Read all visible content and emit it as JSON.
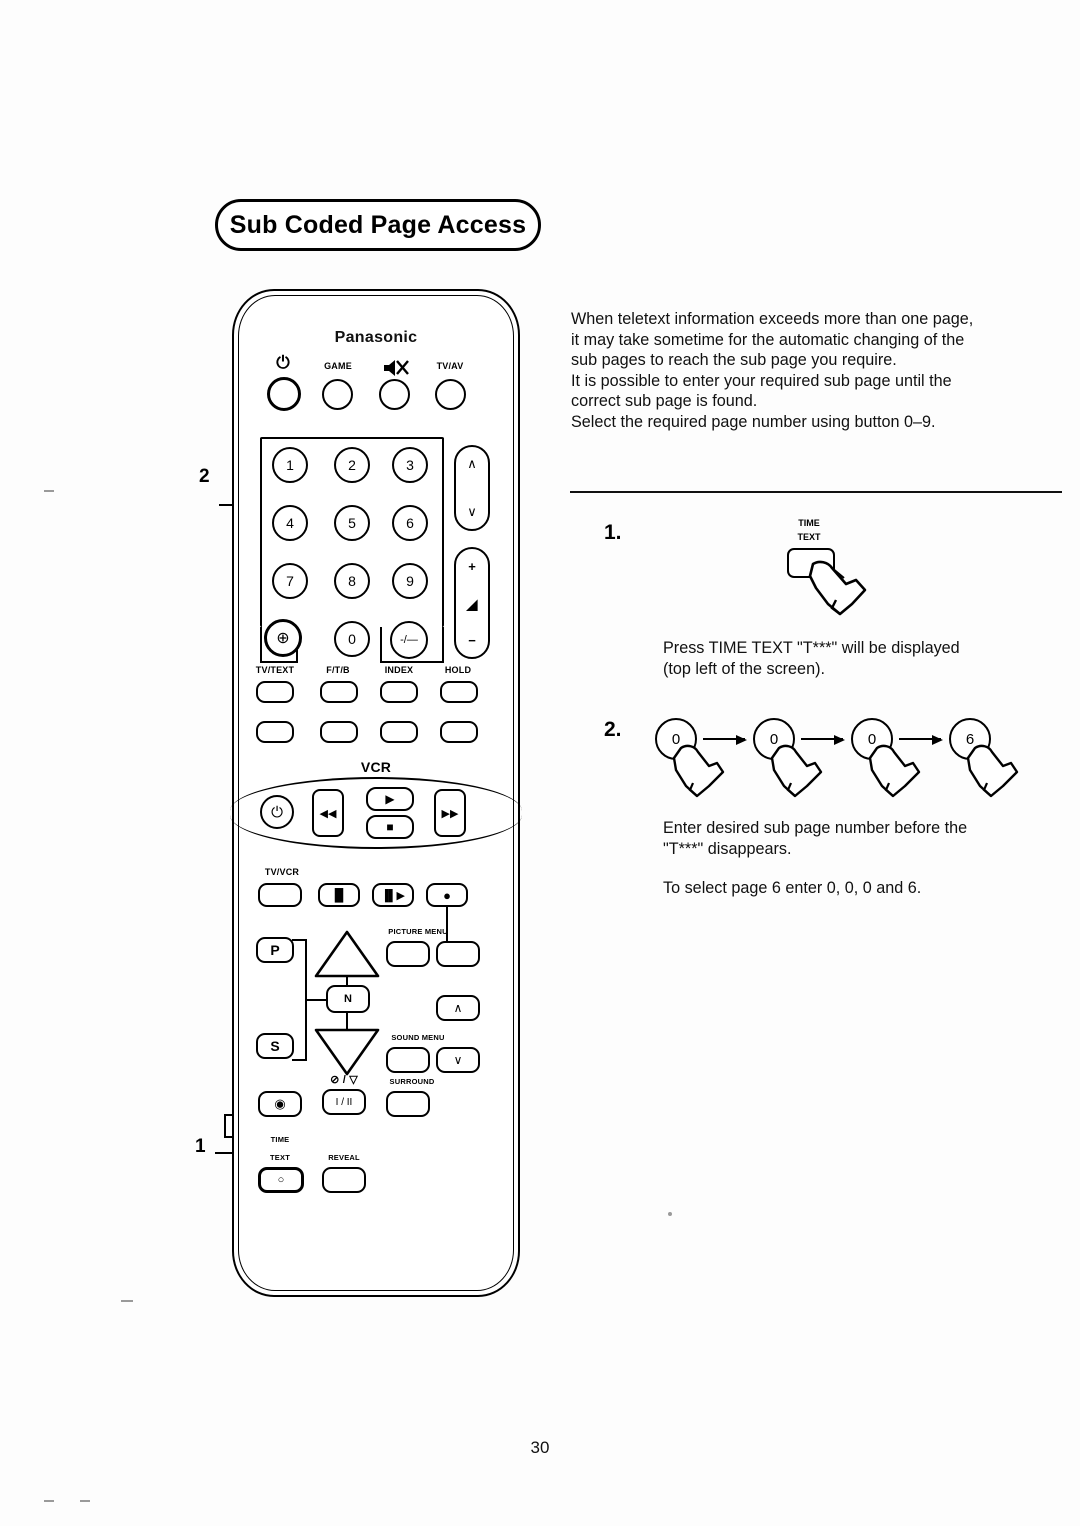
{
  "title": "Sub Coded Page Access",
  "page_number": "30",
  "intro": {
    "lines": [
      "When teletext information exceeds more than one page,",
      "it may take  sometime for the automatic changing of the",
      "sub pages to reach the sub page you require.",
      "It is possible to enter your required sub page until the",
      "correct sub page is found.",
      "Select the required page number using button 0–9."
    ]
  },
  "steps": [
    {
      "number": "1.",
      "key_label_top": "TIME",
      "key_label_bottom": "TEXT",
      "lines": [
        "Press TIME TEXT \"T***\" will be displayed",
        "(top left of the screen)."
      ]
    },
    {
      "number": "2.",
      "keys": [
        "0",
        "0",
        "0",
        "6"
      ],
      "lines": [
        "Enter desired sub page number before the",
        "\"T***\"   disappears.",
        "To select page 6 enter 0, 0, 0 and 6."
      ]
    }
  ],
  "callouts": [
    {
      "label": "2",
      "points_to": "numeric-keypad"
    },
    {
      "label": "1",
      "points_to": "time-text-button"
    }
  ],
  "remote": {
    "brand": "Panasonic",
    "top_row": [
      {
        "name": "power",
        "glyph": "⏻",
        "label": ""
      },
      {
        "name": "game",
        "glyph": "",
        "label": "GAME"
      },
      {
        "name": "mute",
        "glyph": "",
        "label": ""
      },
      {
        "name": "tv-av",
        "glyph": "",
        "label": "TV/AV"
      }
    ],
    "keypad": {
      "digits": [
        "1",
        "2",
        "3",
        "4",
        "5",
        "6",
        "7",
        "8",
        "9"
      ],
      "bottom": [
        {
          "name": "aspect",
          "glyph": "⊕"
        },
        {
          "name": "zero",
          "glyph": "0"
        },
        {
          "name": "tens-digit",
          "glyph": "-/—"
        }
      ]
    },
    "channel_rocker": {
      "up": "∧",
      "down": "∨"
    },
    "volume_rocker": {
      "up": "+",
      "mid": "◢",
      "down": "−"
    },
    "teletext_row": [
      "TV/TEXT",
      "F/T/B",
      "INDEX",
      "HOLD"
    ],
    "fastext_row": [
      "",
      "",
      "",
      ""
    ],
    "vcr_label": "VCR",
    "vcr_transport": [
      {
        "name": "vcr-power",
        "glyph": "⏻"
      },
      {
        "name": "rewind",
        "glyph": "◀◀"
      },
      {
        "name": "play",
        "glyph": "▶"
      },
      {
        "name": "stop",
        "glyph": "■"
      },
      {
        "name": "fast-forward",
        "glyph": "▶▶"
      }
    ],
    "vcr_row2": {
      "tv_vcr_label": "TV/VCR",
      "buttons": [
        {
          "name": "pause",
          "glyph": "▐▌"
        },
        {
          "name": "slow",
          "glyph": "▐▌▶"
        },
        {
          "name": "record",
          "glyph": "●"
        }
      ]
    },
    "menu_cluster": {
      "p_button": "P",
      "s_button": "S",
      "normal_button": "N",
      "picture_menu_label": "PICTURE MENU",
      "sound_menu_label": "SOUND MENU",
      "up_arrow": "▲",
      "down_arrow": "▼",
      "right_up": "∧",
      "right_down": "∨"
    },
    "bottom_row": {
      "color_button": "◉",
      "stereo_label": "⊘ / ▽",
      "stereo_button": "I / II",
      "surround_label": "SURROUND",
      "time_label": "TIME",
      "text_label": "TEXT",
      "time_text_glyph": "○",
      "reveal_label": "REVEAL"
    }
  }
}
